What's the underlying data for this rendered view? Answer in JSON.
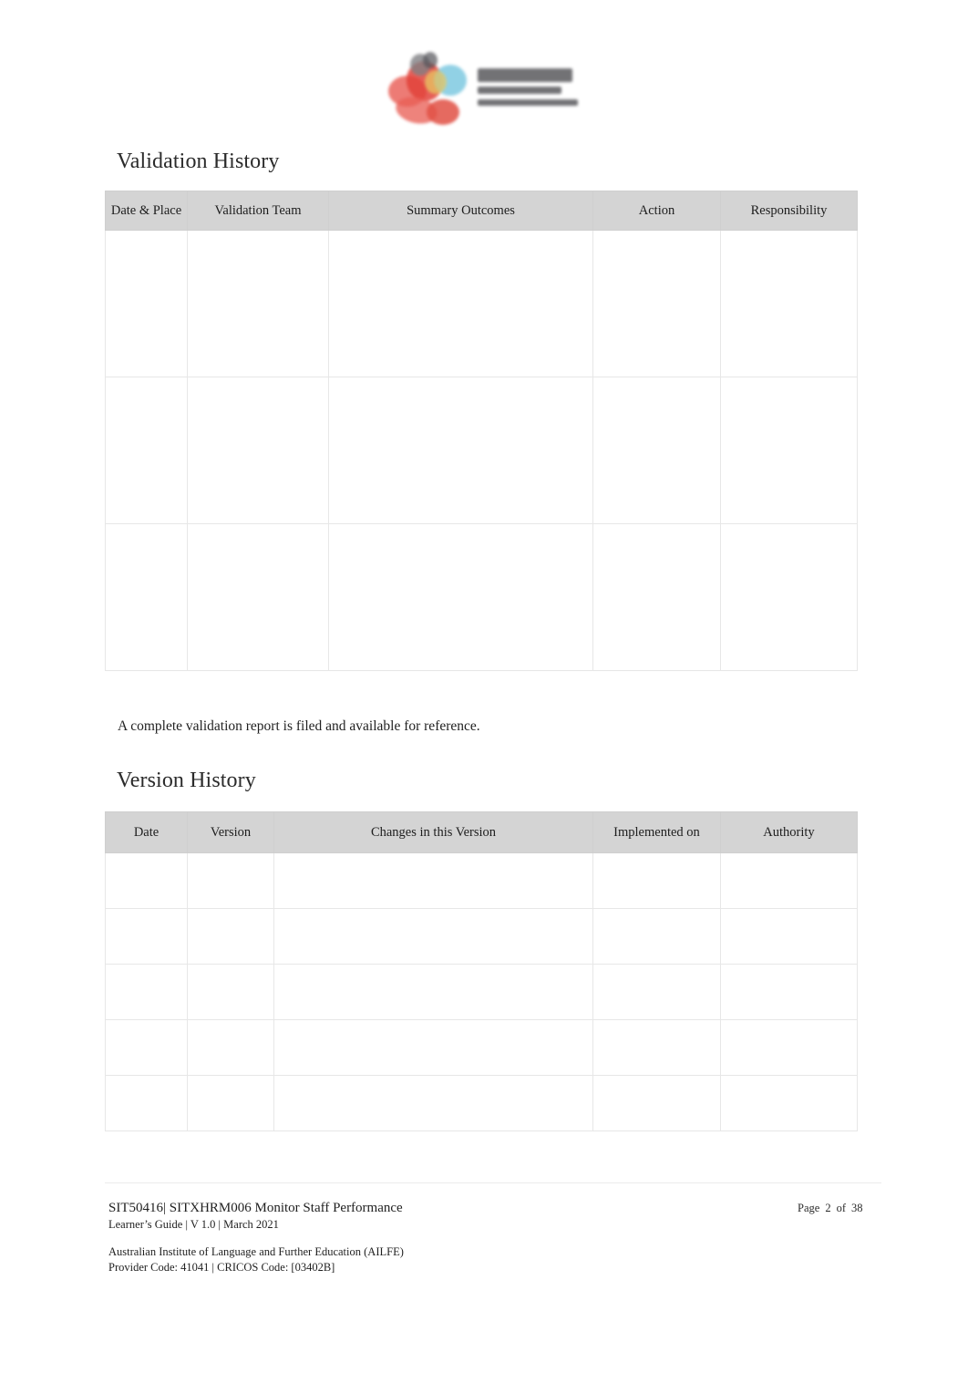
{
  "document": {
    "logo": {
      "mark_name": "ailfe-logo-mark",
      "colors": [
        "#e03b33",
        "#e8584f",
        "#79c7df",
        "#e8c85c",
        "#7c7c80"
      ]
    },
    "headings": {
      "validation_history": "Validation History",
      "version_history": "Version History"
    },
    "paragraphs": {
      "validation_report_note": "A complete validation report is filed and available for reference."
    },
    "validation_history_table": {
      "columns": [
        "Date & Place",
        "Validation Team",
        "Summary Outcomes",
        "Action",
        "Responsibility"
      ],
      "rows": [
        [
          "",
          "",
          "",
          "",
          ""
        ],
        [
          "",
          "",
          "",
          "",
          ""
        ],
        [
          "",
          "",
          "",
          "",
          ""
        ]
      ]
    },
    "version_history_table": {
      "columns": [
        "Date",
        "Version",
        "Changes in this Version",
        "Implemented on",
        "Authority"
      ],
      "rows": [
        [
          "",
          "",
          "",
          "",
          ""
        ],
        [
          "",
          "",
          "",
          "",
          ""
        ],
        [
          "",
          "",
          "",
          "",
          ""
        ],
        [
          "",
          "",
          "",
          "",
          ""
        ],
        [
          "",
          "",
          "",
          "",
          ""
        ]
      ]
    },
    "footer": {
      "course_line": "SIT50416| SITXHRM006 Monitor Staff Performance",
      "guide_line": "Learner’s Guide | V 1.0 | March 2021",
      "page_label": "Page",
      "page_number": "2",
      "page_of": "of",
      "page_total": "38",
      "organisation": "Australian Institute of Language and Further Education (AILFE)",
      "codes": "Provider Code: 41041 | CRICOS Code: [03402B]"
    }
  }
}
